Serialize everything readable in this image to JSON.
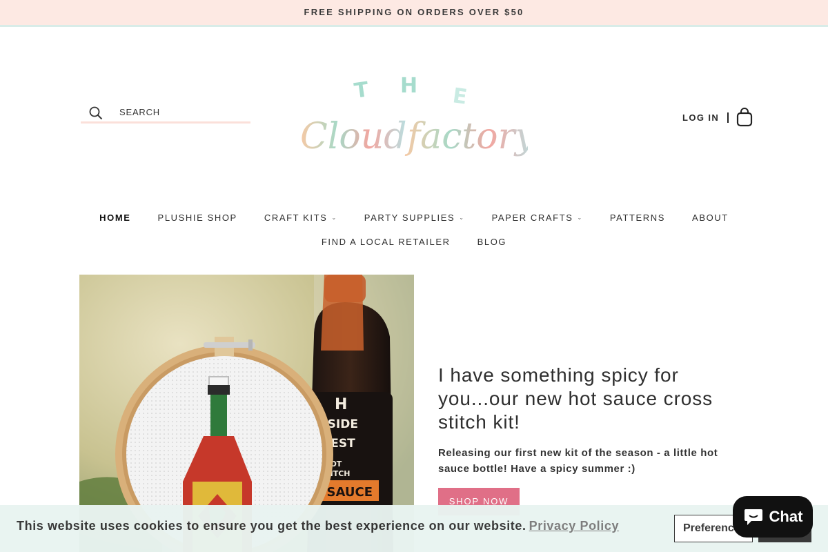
{
  "announcement": {
    "text": "FREE SHIPPING ON ORDERS OVER $50"
  },
  "header": {
    "search_label": "SEARCH",
    "login_label": "LOG IN",
    "logo": {
      "word1": "THE",
      "word2": "Cloud factory"
    }
  },
  "nav": {
    "row1": [
      {
        "label": "HOME",
        "active": true,
        "dropdown": false
      },
      {
        "label": "PLUSHIE SHOP",
        "active": false,
        "dropdown": false
      },
      {
        "label": "CRAFT KITS",
        "active": false,
        "dropdown": true
      },
      {
        "label": "PARTY SUPPLIES",
        "active": false,
        "dropdown": true
      },
      {
        "label": "PAPER CRAFTS",
        "active": false,
        "dropdown": true
      },
      {
        "label": "PATTERNS",
        "active": false,
        "dropdown": false
      },
      {
        "label": "ABOUT",
        "active": false,
        "dropdown": false
      }
    ],
    "row2": [
      {
        "label": "FIND A LOCAL RETAILER",
        "active": false,
        "dropdown": false
      },
      {
        "label": "BLOG",
        "active": false,
        "dropdown": false
      }
    ]
  },
  "hero": {
    "title": "I have something spicy for you...our new hot sauce cross stitch kit!",
    "text": "Releasing our first new kit of the season - a little hot sauce bottle! Have a spicy summer :)",
    "button": "SHOP NOW",
    "image_label": {
      "line1": "LLSIDE",
      "line2": "RVEST",
      "line3": "ARROT",
      "line4": "COVITCH",
      "line5": "T SAUCE"
    }
  },
  "cookie_banner": {
    "text": "This website uses cookies to ensure you get the best experience on our website.",
    "link": "Privacy Policy",
    "preferences_button": "Preferences",
    "accept_button": ""
  },
  "chat_widget": {
    "label": "Chat"
  },
  "colors": {
    "announcement_bg": "#fde9e3",
    "button_pink": "#e06f87",
    "cookie_bg": "#e9f4f1",
    "chat_bg": "#111111"
  }
}
